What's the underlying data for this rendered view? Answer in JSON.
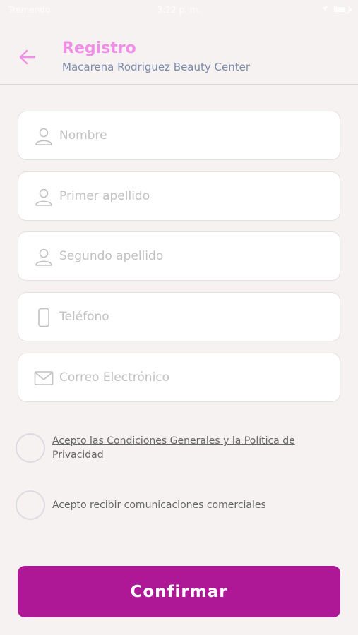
{
  "status_bar": {
    "carrier": "Tremendo",
    "time": "3:22 p. m."
  },
  "header": {
    "title": "Registro",
    "subtitle": "Macarena Rodriguez Beauty Center",
    "back_icon": "arrow-left-icon"
  },
  "form": {
    "fields": [
      {
        "icon": "user-icon",
        "placeholder": "Nombre",
        "value": ""
      },
      {
        "icon": "user-icon",
        "placeholder": "Primer apellido",
        "value": ""
      },
      {
        "icon": "user-icon",
        "placeholder": "Segundo apellido",
        "value": ""
      },
      {
        "icon": "phone-icon",
        "placeholder": "Teléfono",
        "value": ""
      },
      {
        "icon": "mail-icon",
        "placeholder": "Correo Electrónico",
        "value": ""
      }
    ]
  },
  "checks": {
    "terms": {
      "line1": "Acepto las Condiciones Generales y la Política de",
      "line2": "Privacidad",
      "checked": false
    },
    "marketing": {
      "label": "Acepto recibir comunicaciones comerciales",
      "checked": false
    }
  },
  "confirm_label": "Confirmar",
  "colors": {
    "accent": "#f08fe6",
    "primary_button": "#ae1897",
    "subtitle": "#7a8aa8",
    "background": "#f6f2f2"
  }
}
